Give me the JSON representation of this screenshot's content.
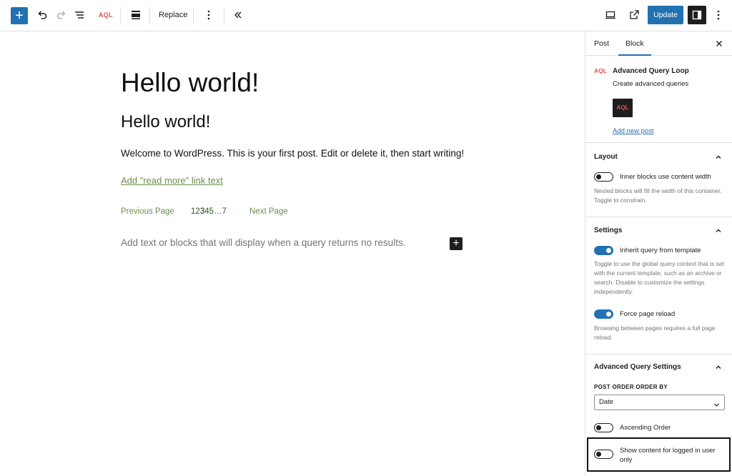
{
  "toolbar": {
    "add_block": "+",
    "aql_label": "AQL",
    "replace_label": "Replace",
    "update_label": "Update"
  },
  "editor": {
    "heading1": "Hello world!",
    "heading2": "Hello world!",
    "paragraph": "Welcome to WordPress. This is your first post. Edit or delete it, then start writing!",
    "read_more": "Add \"read more\" link text",
    "previous_page": "Previous Page",
    "page_numbers": [
      "1",
      "2",
      "3",
      "4",
      "5",
      "…",
      "7"
    ],
    "current_page": "3",
    "next_page": "Next Page",
    "no_results": "Add text or blocks that will display when a query returns no results.",
    "inserter": "+"
  },
  "sidebar": {
    "tabs": {
      "post": "Post",
      "block": "Block"
    },
    "block_card": {
      "icon_text": "AQL",
      "title": "Advanced Query Loop",
      "description": "Create advanced queries",
      "logo_text": "AQL",
      "link": "Add new post"
    },
    "layout": {
      "title": "Layout",
      "toggle_label": "Inner blocks use content width",
      "toggle_on": false,
      "help": "Nested blocks will fill the width of this container. Toggle to constrain."
    },
    "settings": {
      "title": "Settings",
      "inherit_label": "Inherit query from template",
      "inherit_on": true,
      "inherit_help": "Toggle to use the global query context that is set with the current template, such as an archive or search. Disable to customize the settings independently.",
      "reload_label": "Force page reload",
      "reload_on": true,
      "reload_help": "Browsing between pages requires a full page reload."
    },
    "advanced": {
      "title": "Advanced Query Settings",
      "order_by_label": "POST ORDER ORDER BY",
      "order_by_value": "Date",
      "ascending_label": "Ascending Order",
      "ascending_on": false,
      "logged_in_label": "Show content for logged in user only",
      "logged_in_on": false
    }
  },
  "colors": {
    "accent": "#2271b1",
    "link_green": "#6b8f4e",
    "aql_red": "#d9534f"
  }
}
